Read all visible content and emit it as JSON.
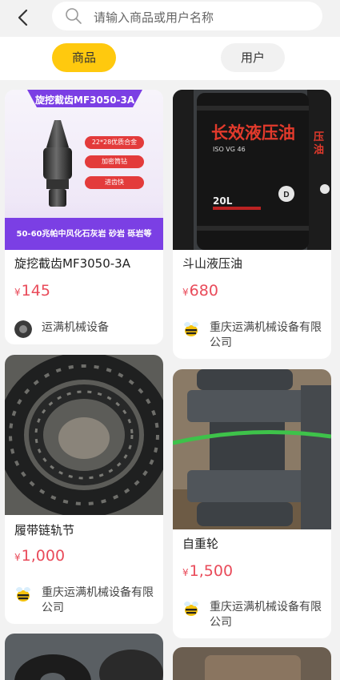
{
  "search": {
    "placeholder": "请输入商品或用户名称"
  },
  "tabs": [
    {
      "label": "商品"
    },
    {
      "label": "用户"
    }
  ],
  "products": [
    {
      "title": "旋挖截齿MF3050-3A",
      "currency": "¥",
      "price": "145",
      "seller": "运满机械设备",
      "banner": {
        "heading": "旋挖截齿MF3050-3A",
        "badges": [
          "22*28优质合金",
          "加密筒钻",
          "进齿快"
        ],
        "footer": "50-60兆帕中风化石灰岩 砂岩 砾岩等"
      }
    },
    {
      "title": "斗山液压油",
      "currency": "¥",
      "price": "680",
      "seller": "重庆运满机械设备有限公司",
      "drum": {
        "main": "长效液压油",
        "grade": "ISO VG 46",
        "volume": "20L",
        "side": "压油"
      }
    },
    {
      "title": "履带链轨节",
      "currency": "¥",
      "price": "1,000",
      "seller": "重庆运满机械设备有限公司"
    },
    {
      "title": "自重轮",
      "currency": "¥",
      "price": "1,500",
      "seller": "重庆运满机械设备有限公司"
    }
  ],
  "colors": {
    "accent": "#ffc90e",
    "price": "#e94b5a",
    "banner_purple": "#7b3fe4"
  }
}
